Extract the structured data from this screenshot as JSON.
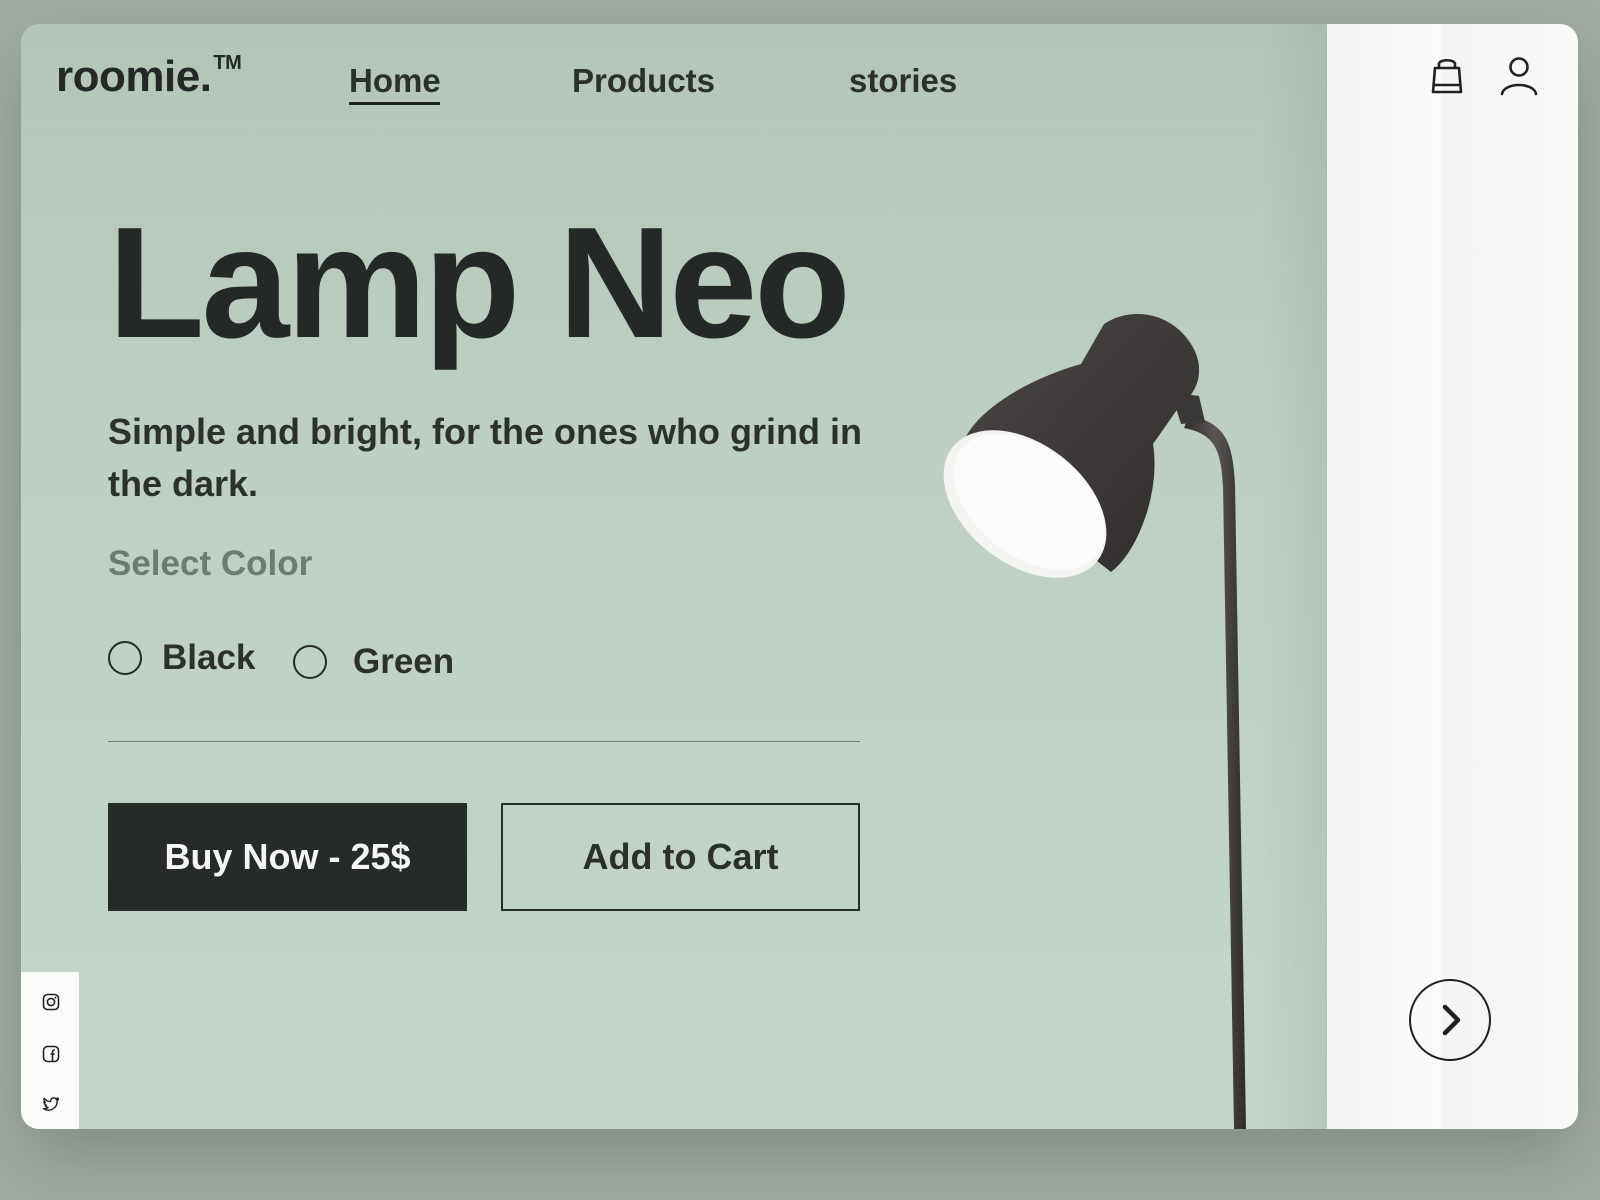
{
  "brand": {
    "name": "roomie.",
    "trademark": "TM"
  },
  "nav": {
    "items": [
      {
        "label": "Home",
        "active": true
      },
      {
        "label": "Products",
        "active": false
      },
      {
        "label": "stories",
        "active": false
      }
    ]
  },
  "header_icons": [
    "shopping-bag-icon",
    "user-icon"
  ],
  "hero": {
    "title": "Lamp Neo",
    "subtitle": "Simple and bright, for the ones who grind in the dark."
  },
  "color_select": {
    "label": "Select Color",
    "options": [
      {
        "label": "Black",
        "selected": false
      },
      {
        "label": "Green",
        "selected": false
      }
    ]
  },
  "actions": {
    "buy_label": "Buy Now - 25$",
    "cart_label": "Add to Cart"
  },
  "social_icons": [
    "instagram-icon",
    "facebook-icon",
    "twitter-icon"
  ],
  "next_icon": "chevron-right-icon",
  "colors": {
    "background": "#a2ada3",
    "wall": "#bfcfc3",
    "dark": "#272b28",
    "muted": "#6f7a71",
    "panel": "#fbfbfa"
  }
}
